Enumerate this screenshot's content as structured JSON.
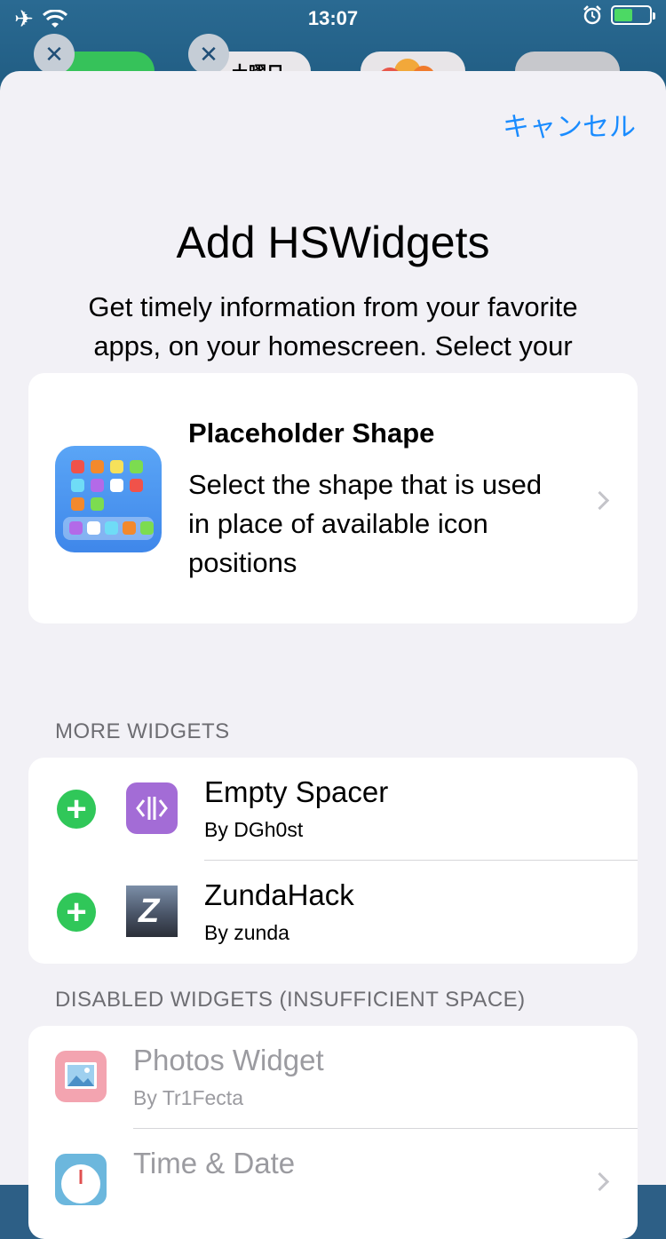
{
  "status": {
    "time": "13:07",
    "airplane_icon": "airplane-icon",
    "wifi_icon": "wifi-icon",
    "alarm_icon": "alarm-icon"
  },
  "background": {
    "partial_label": "土曜日"
  },
  "sheet": {
    "cancel_label": "キャンセル",
    "title": "Add HSWidgets",
    "subtitle": "Get timely information from your favorite apps, on your homescreen. Select your HSWidget below."
  },
  "placeholder": {
    "title": "Placeholder Shape",
    "description": "Select the shape that is used in place of available icon positions"
  },
  "more_widgets": {
    "header": "MORE WIDGETS",
    "items": [
      {
        "title": "Empty Spacer",
        "author": "By DGh0st",
        "icon": "spacer-icon"
      },
      {
        "title": "ZundaHack",
        "author": "By zunda",
        "icon": "zundahack-icon"
      }
    ]
  },
  "disabled_widgets": {
    "header": "DISABLED WIDGETS (INSUFFICIENT SPACE)",
    "items": [
      {
        "title": "Photos Widget",
        "author": "By Tr1Fecta",
        "icon": "photos-icon"
      },
      {
        "title": "Time & Date",
        "author": "",
        "icon": "clock-icon"
      }
    ]
  },
  "colors": {
    "accent": "#1a8cff",
    "add_green": "#30c759",
    "sheet_bg": "#f2f1f6",
    "secondary_text": "#6d6d72"
  }
}
